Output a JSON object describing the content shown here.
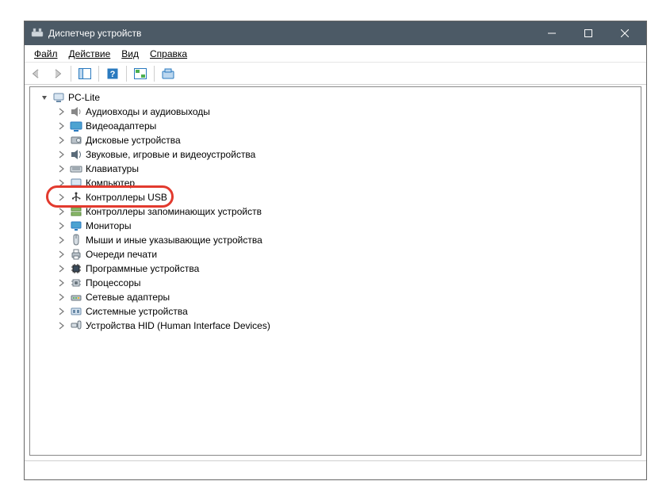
{
  "title": "Диспетчер устройств",
  "menu": {
    "file": "Файл",
    "action": "Действие",
    "view": "Вид",
    "help": "Справка"
  },
  "tree": {
    "root": "PC-Lite",
    "items": [
      {
        "icon": "audio",
        "label": "Аудиовходы и аудиовыходы"
      },
      {
        "icon": "display",
        "label": "Видеоадаптеры"
      },
      {
        "icon": "disk",
        "label": "Дисковые устройства"
      },
      {
        "icon": "sound",
        "label": "Звуковые, игровые и видеоустройства"
      },
      {
        "icon": "keyboard",
        "label": "Клавиатуры"
      },
      {
        "icon": "computer",
        "label": "Компьютер"
      },
      {
        "icon": "usb",
        "label": "Контроллеры USB",
        "highlighted": true
      },
      {
        "icon": "storage",
        "label": "Контроллеры запоминающих устройств"
      },
      {
        "icon": "monitor",
        "label": "Мониторы"
      },
      {
        "icon": "mouse",
        "label": "Мыши и иные указывающие устройства"
      },
      {
        "icon": "printer",
        "label": "Очереди печати"
      },
      {
        "icon": "chip",
        "label": "Программные устройства"
      },
      {
        "icon": "cpu",
        "label": "Процессоры"
      },
      {
        "icon": "network",
        "label": "Сетевые адаптеры"
      },
      {
        "icon": "system",
        "label": "Системные устройства"
      },
      {
        "icon": "hid",
        "label": "Устройства HID (Human Interface Devices)"
      }
    ]
  }
}
